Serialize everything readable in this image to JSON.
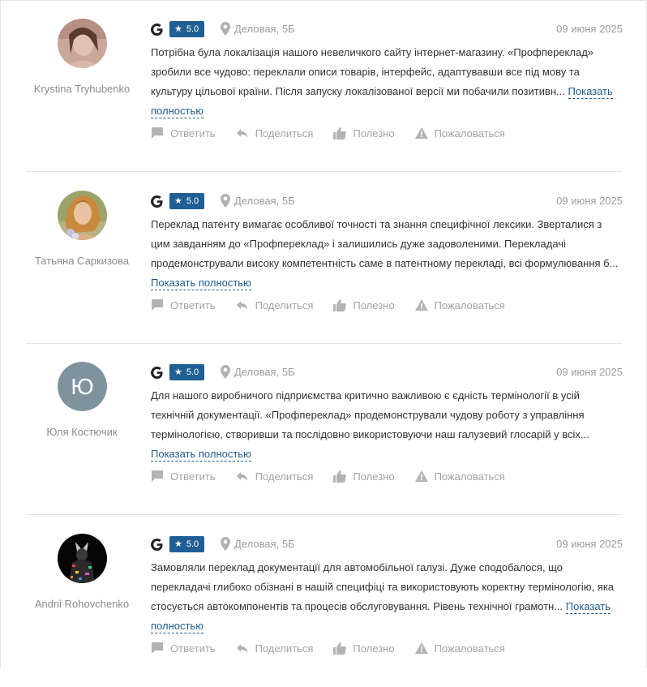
{
  "labels": {
    "more": "Показать полностью",
    "reply": "Ответить",
    "share": "Поделиться",
    "useful": "Полезно",
    "report": "Пожаловаться"
  },
  "reviews": [
    {
      "author": "Krystina Tryhubenko",
      "avatar": "photo-woman-1",
      "rating": "5.0",
      "source": "google",
      "place": "Деловая, 5Б",
      "date": "09 июня 2025",
      "text": "Потрібна була локалізація нашого невеличкого сайту інтернет-магазину. «Профпереклад» зробили все чудово: переклали описи товарів, інтерфейс, адаптувавши все під мову та культуру цільової країни. Після запуску локалізованої версії ми побачили позитивн..."
    },
    {
      "author": "Татьяна Саркизова",
      "avatar": "photo-woman-2",
      "rating": "5.0",
      "source": "google",
      "place": "Деловая, 5Б",
      "date": "09 июня 2025",
      "text": "Переклад патенту вимагає особливої точності та знання специфічної лексики. Зверталися з цим завданням до «Профпереклад» і залишились дуже задоволеними. Перекладачі продемонстрували високу компетентність саме в патентному перекладі, всі формулювання б..."
    },
    {
      "author": "Юля Костючик",
      "avatar": "letter",
      "avatar_letter": "Ю",
      "rating": "5.0",
      "source": "google",
      "place": "Деловая, 5Б",
      "date": "09 июня 2025",
      "text": "Для нашого виробничого підприємства критично важливою є єдність термінології в усій технічній документації. «Профпереклад» продемонстрували чудову роботу з управління термінологією, створивши та послідовно використовуючи наш галузевий глосарій у всіх..."
    },
    {
      "author": "Andrii Rohovchenko",
      "avatar": "photo-dark-figure",
      "rating": "5.0",
      "source": "google",
      "place": "Деловая, 5Б",
      "date": "09 июня 2025",
      "text": "Замовляли переклад документації для автомобільної галузі. Дуже сподобалося, що перекладачі глибоко обізнані в нашій специфіці та використовують коректну термінологію, яка стосується автокомпонентів та процесів обслуговування. Рівень технічної грамотн..."
    }
  ],
  "colors": {
    "rating_badge": "#1f5f94",
    "link": "#1e5a8f",
    "muted": "#9b9b9b"
  }
}
